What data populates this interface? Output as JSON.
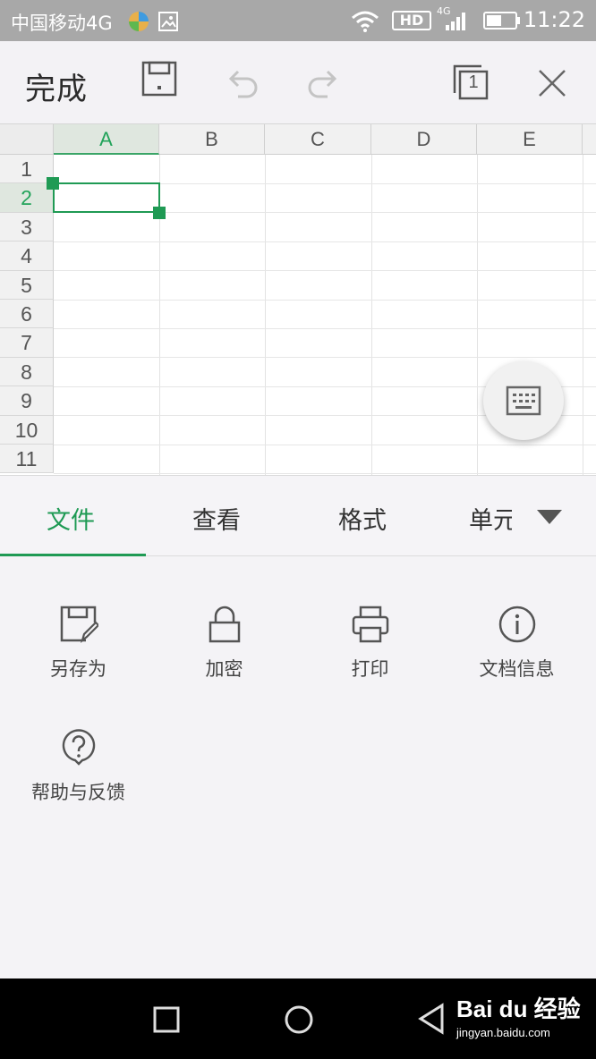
{
  "status_bar": {
    "carrier": "中国移动4G",
    "network_4g": "4G",
    "hd_badge": "HD",
    "time": "11:22"
  },
  "toolbar": {
    "done_label": "完成",
    "sheet_count": "1"
  },
  "sheet": {
    "columns": [
      "A",
      "B",
      "C",
      "D",
      "E"
    ],
    "rows": [
      "1",
      "2",
      "3",
      "4",
      "5",
      "6",
      "7",
      "8",
      "9",
      "10",
      "11"
    ],
    "selected_column": "A",
    "selected_row": "2"
  },
  "tabs": {
    "items": [
      "文件",
      "查看",
      "格式",
      "单元"
    ],
    "active": "文件"
  },
  "panel": {
    "actions": [
      {
        "label": "另存为",
        "icon": "save-as-icon"
      },
      {
        "label": "加密",
        "icon": "lock-icon"
      },
      {
        "label": "打印",
        "icon": "printer-icon"
      },
      {
        "label": "文档信息",
        "icon": "info-icon"
      },
      {
        "label": "帮助与反馈",
        "icon": "help-icon"
      }
    ]
  },
  "watermark": {
    "brand": "Bai du 经验",
    "url": "jingyan.baidu.com"
  },
  "colors": {
    "accent": "#1f9a54",
    "status_bar": "#a8a8a8",
    "nav_bar": "#000000"
  }
}
